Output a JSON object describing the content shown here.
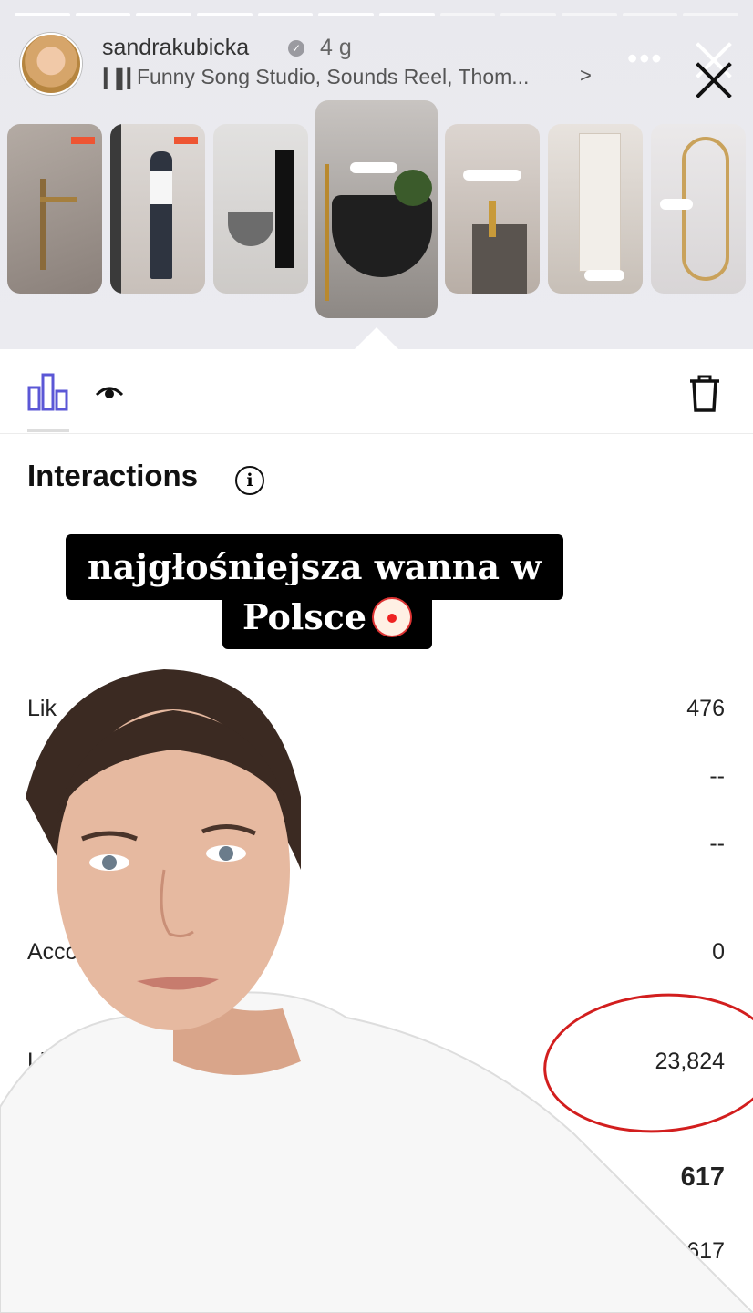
{
  "story": {
    "username": "sandrakubicka",
    "age": "4 g",
    "music": "Funny Song Studio, Sounds Reel, Thom...",
    "music_chevron": ">",
    "more_icon": "more-horizontal-icon",
    "close_icon": "close-icon",
    "progress_segments": 12
  },
  "thumbnails": [
    {
      "name": "thumb-1"
    },
    {
      "name": "thumb-2"
    },
    {
      "name": "thumb-3"
    },
    {
      "name": "thumb-selected"
    },
    {
      "name": "thumb-5"
    },
    {
      "name": "thumb-6"
    },
    {
      "name": "thumb-7"
    }
  ],
  "insights": {
    "section_title": "Interactions",
    "rows": [
      {
        "label": "Lik",
        "value": "476"
      },
      {
        "label": "",
        "value": "--"
      },
      {
        "label": "",
        "value": "--"
      },
      {
        "label": "Acco",
        "value": "0"
      },
      {
        "label": "Link cl",
        "value": "23,824"
      },
      {
        "label": "",
        "value": "617"
      },
      {
        "label": "",
        "value": "617"
      }
    ]
  },
  "caption": {
    "line1": "najgłośniejsza wanna w",
    "line2": "Polsce"
  },
  "colors": {
    "accent_icon": "#5b57d6",
    "annotation": "#d21e1e"
  }
}
